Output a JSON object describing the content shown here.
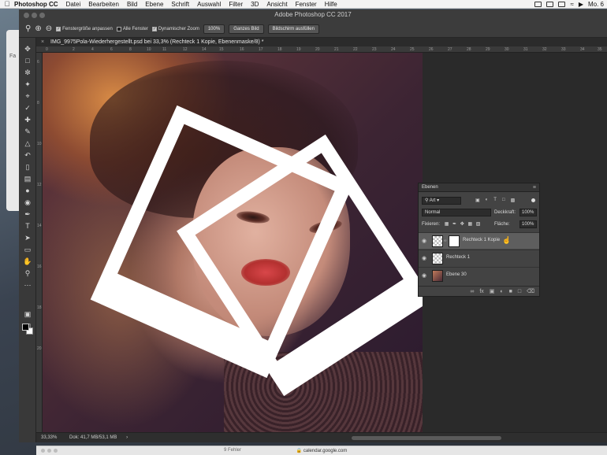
{
  "menubar": {
    "app_name": "Photoshop CC",
    "items": [
      "Datei",
      "Bearbeiten",
      "Bild",
      "Ebene",
      "Schrift",
      "Auswahl",
      "Filter",
      "3D",
      "Ansicht",
      "Fenster",
      "Hilfe"
    ],
    "clock": "Mo. 6"
  },
  "window": {
    "title": "Adobe Photoshop CC 2017"
  },
  "options_bar": {
    "resize_windows": "Fenstergröße anpassen",
    "all_windows": "Alle Fenster",
    "scrubby_zoom": "Dynamischer Zoom",
    "zoom_100": "100%",
    "fit_screen": "Ganzes Bild",
    "fill_screen": "Bildschirm ausfüllen"
  },
  "document": {
    "tab_title": "IMG_9975Pola-Wiederhergestellt.psd bei 33,3% (Rechteck 1 Kopie, Ebenenmaske/8) *",
    "ruler_top": [
      "0",
      "2",
      "4",
      "6",
      "8",
      "10",
      "11",
      "12",
      "14",
      "15",
      "16",
      "17",
      "18",
      "19",
      "20",
      "21",
      "22",
      "23",
      "24",
      "25",
      "26",
      "27",
      "28",
      "29",
      "30",
      "31",
      "32",
      "33",
      "34",
      "35",
      "36",
      "37"
    ],
    "ruler_left": [
      "6",
      "8",
      "10",
      "12",
      "14",
      "16",
      "18",
      "20"
    ]
  },
  "status": {
    "zoom": "33,33%",
    "doc_size": "Dok: 41,7 MB/53,1 MB"
  },
  "layers_panel": {
    "title": "Ebenen",
    "filter_kind": "Art",
    "blend_mode": "Normal",
    "opacity_label": "Deckkraft:",
    "opacity_value": "100%",
    "lock_label": "Fixieren:",
    "fill_label": "Fläche:",
    "fill_value": "100%",
    "layers": [
      {
        "name": "Rechteck 1 Kopie",
        "selected": true
      },
      {
        "name": "Rechteck 1",
        "selected": false
      },
      {
        "name": "Ebene 30",
        "selected": false
      }
    ]
  },
  "bottom_window": {
    "url": "calendar.google.com",
    "badge": "9 Fehler"
  }
}
